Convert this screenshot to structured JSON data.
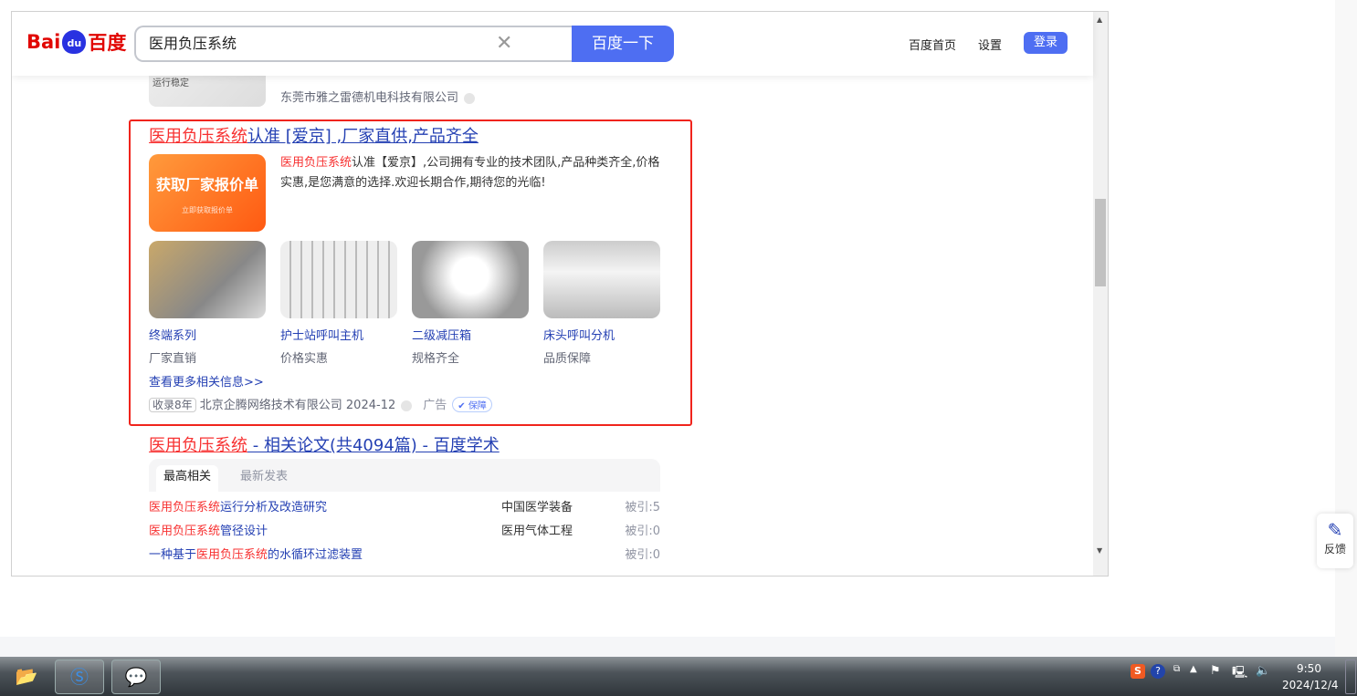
{
  "header": {
    "logo": "Bai du 百度",
    "search_value": "医用负压系统",
    "search_button": "百度一下",
    "links": [
      "百度首页",
      "设置"
    ],
    "login": "登录"
  },
  "prev_result": {
    "source": "东莞市雅之雷德机电科技有限公司",
    "img_text": "运行稳定"
  },
  "ad": {
    "title_red": "医用负压系统",
    "title_rest": "认准 [爱京] ,厂家直供,产品齐全",
    "img_text": "获取厂家报价单",
    "img_badge": "立即获取报价单",
    "desc_red": "医用负压系统",
    "desc_rest": "认准【爱京】,公司拥有专业的技术团队,产品种类齐全,价格实惠,是您满意的选择.欢迎长期合作,期待您的光临!",
    "products": [
      {
        "name": "终端系列",
        "sub": "厂家直销"
      },
      {
        "name": "护士站呼叫主机",
        "sub": "价格实惠"
      },
      {
        "name": "二级减压箱",
        "sub": "规格齐全"
      },
      {
        "name": "床头呼叫分机",
        "sub": "品质保障"
      }
    ],
    "more": "查看更多相关信息>>",
    "tag": "收录8年",
    "company": "北京企腾网络技术有限公司 2024-12",
    "ad_label": "广告",
    "guarantee": "保障"
  },
  "scholar": {
    "title_red": "医用负压系统",
    "title_rest": " - 相关论文(共4094篇) - 百度学术",
    "tabs": [
      "最高相关",
      "最新发表"
    ],
    "rows": [
      {
        "pre": "",
        "red": "医用负压系统",
        "post": "运行分析及改造研究",
        "journal": "中国医学装备",
        "cite": "被引:5"
      },
      {
        "pre": "",
        "red": "医用负压系统",
        "post": "管径设计",
        "journal": "医用气体工程",
        "cite": "被引:0"
      },
      {
        "pre": "一种基于",
        "red": "医用负压系统",
        "post": "的水循环过滤装置",
        "journal": "",
        "cite": "被引:0"
      }
    ]
  },
  "feedback": "反馈",
  "tray": {
    "time": "9:50",
    "date": "2024/12/4"
  }
}
